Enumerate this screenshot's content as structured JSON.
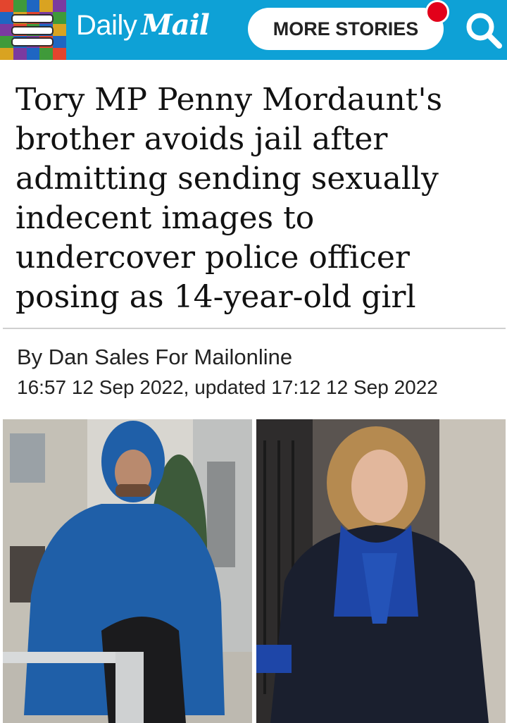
{
  "header": {
    "brand_light": "Daily",
    "brand_bold": "Mail",
    "more_stories_label": "MORE STORIES",
    "brand_color": "#0ea1d6",
    "notification_color": "#e2001a",
    "menu_icon": "hamburger-menu-icon",
    "search_icon": "search-icon"
  },
  "article": {
    "headline": "Tory MP Penny Mordaunt's brother avoids jail after admitting sending sexually indecent images to undercover police officer posing as 14-year-old girl",
    "byline": "By Dan Sales For Mailonline",
    "dateline": "16:57 12 Sep 2022, updated 17:12 12 Sep 2022"
  }
}
